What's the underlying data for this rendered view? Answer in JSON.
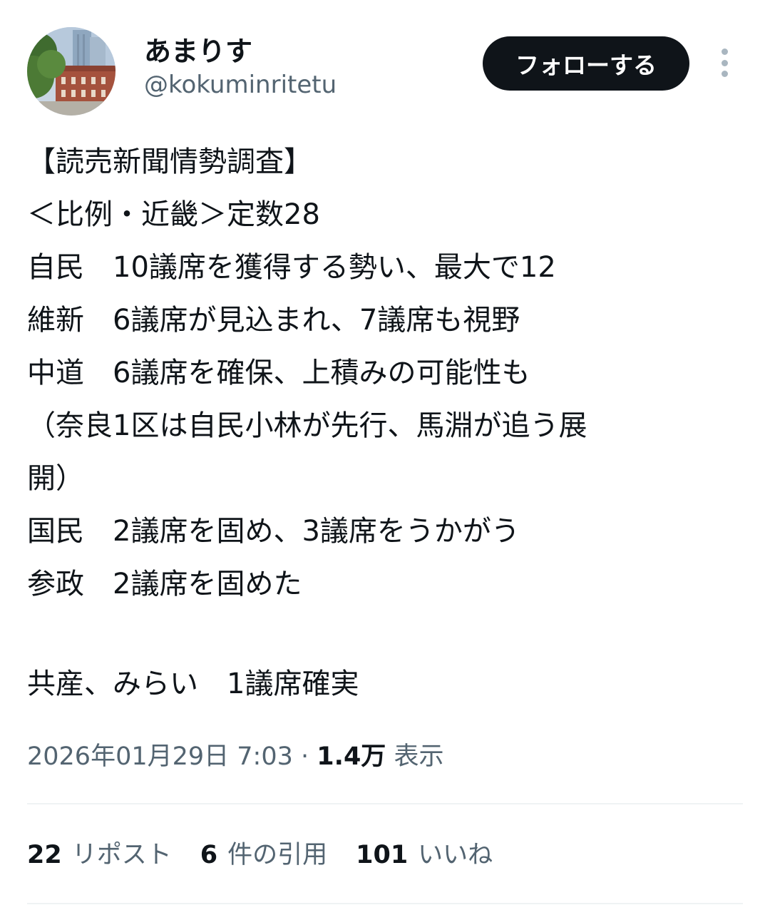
{
  "user": {
    "display_name": "あまりす",
    "handle": "@kokuminritetu"
  },
  "actions": {
    "follow_label": "フォローする",
    "more_icon": "more-vertical-icon"
  },
  "tweet": {
    "lines": [
      "【読売新聞情勢調査】",
      "＜比例・近畿＞定数28",
      "自民　10議席を獲得する勢い、最大で12",
      "維新　6議席が見込まれ、7議席も視野",
      "中道　6議席を確保、上積みの可能性も",
      "（奈良1区は自民小林が先行、馬淵が追う展",
      "開）",
      "国民　2議席を固め、3議席をうかがう",
      "参政　2議席を固めた",
      "",
      "共産、みらい　1議席確実"
    ]
  },
  "meta": {
    "datetime": "2026年01月29日 7:03",
    "separator": "·",
    "views_count": "1.4万",
    "views_label": "表示"
  },
  "stats": {
    "reposts_count": "22",
    "reposts_label": "リポスト",
    "quotes_count": "6",
    "quotes_label": "件の引用",
    "likes_count": "101",
    "likes_label": "いいね"
  }
}
